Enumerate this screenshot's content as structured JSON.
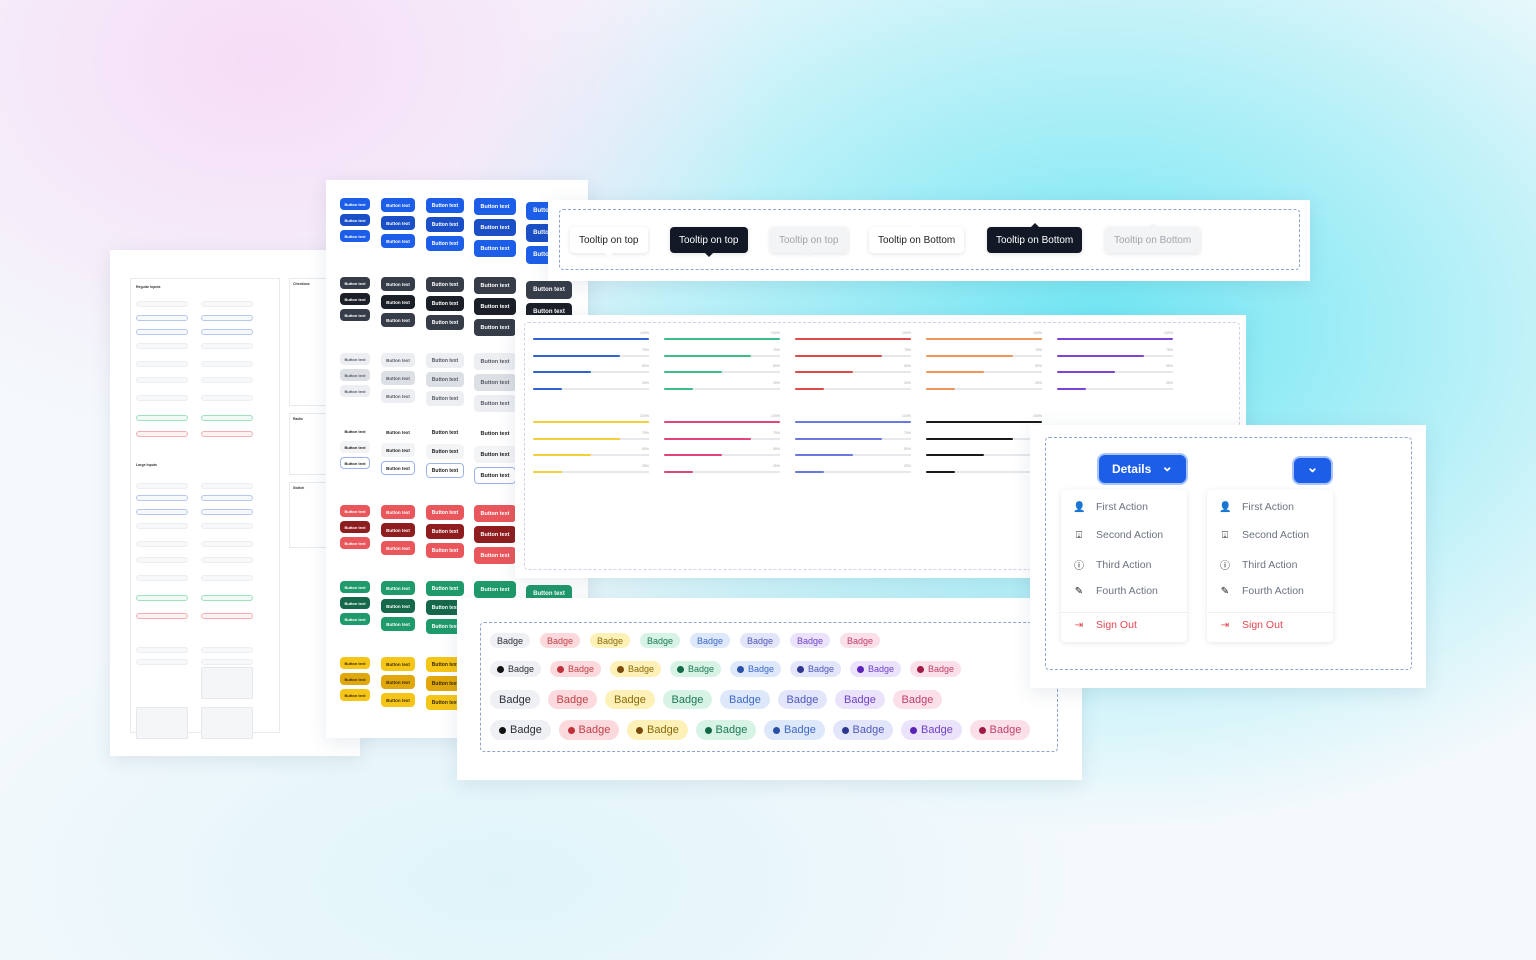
{
  "forms": {
    "regular_title": "Regular Inputs",
    "large_title": "Large Inputs",
    "checkbox_title": "Checkbox",
    "radio_title": "Radio",
    "switch_title": "Switch"
  },
  "buttons": {
    "label": "Button text",
    "groups": [
      {
        "name": "primary",
        "colors": [
          "#1d5ee8",
          "#1a4fc6",
          "#1d5ee8"
        ],
        "text": "#ffffff"
      },
      {
        "name": "dark",
        "colors": [
          "#363c48",
          "#1b1f28",
          "#363c48"
        ],
        "text": "#ffffff"
      },
      {
        "name": "light",
        "colors": [
          "#eceef1",
          "#dcdfe4",
          "#eceef1"
        ],
        "text": "#555b66"
      },
      {
        "name": "outline",
        "colors": [
          "#ffffff",
          "#f3f4f6",
          "#ffffff"
        ],
        "text": "#222222",
        "border": "#9db4ea"
      },
      {
        "name": "danger",
        "colors": [
          "#e9575c",
          "#8f1c1f",
          "#e9575c"
        ],
        "text": "#ffffff"
      },
      {
        "name": "success",
        "colors": [
          "#1f9a6a",
          "#15684a",
          "#1f9a6a"
        ],
        "text": "#ffffff"
      },
      {
        "name": "warning",
        "colors": [
          "#f5c518",
          "#e0a80c",
          "#f5c518"
        ],
        "text": "#3a2a00"
      }
    ]
  },
  "tooltips": [
    {
      "label": "Tooltip on top",
      "style": "light",
      "arrow": "bottom"
    },
    {
      "label": "Tooltip on top",
      "style": "dark",
      "arrow": "bottom"
    },
    {
      "label": "Tooltip on top",
      "style": "muted",
      "arrow": "bottom"
    },
    {
      "label": "Tooltip on Bottom",
      "style": "light",
      "arrow": "top"
    },
    {
      "label": "Tooltip on Bottom",
      "style": "dark",
      "arrow": "top"
    },
    {
      "label": "Tooltip on Bottom",
      "style": "muted",
      "arrow": "top"
    }
  ],
  "progress": {
    "values": [
      100,
      75,
      50,
      25
    ],
    "labels": [
      "100%",
      "75%",
      "50%",
      "25%"
    ],
    "colors": [
      "#2f62d3",
      "#3dbd8a",
      "#dc4a4a",
      "#f0955a",
      "#7b43d6",
      "#f5cf3a",
      "#e0457d",
      "#6a79e0",
      "#1a1a1a"
    ]
  },
  "badges": {
    "label": "Badge",
    "colors": [
      {
        "bg": "#eef0f3",
        "fg": "#2a2f38",
        "dot": "#111"
      },
      {
        "bg": "#fbd9dc",
        "fg": "#c0424a",
        "dot": "#c0303a"
      },
      {
        "bg": "#fdf1b8",
        "fg": "#8a6a08",
        "dot": "#7a4a08"
      },
      {
        "bg": "#d7f3e6",
        "fg": "#1c7a52",
        "dot": "#136845"
      },
      {
        "bg": "#dde8fb",
        "fg": "#3f68c8",
        "dot": "#2a4fa8"
      },
      {
        "bg": "#e3e6fb",
        "fg": "#4f58b8",
        "dot": "#2e3690"
      },
      {
        "bg": "#ebe3fb",
        "fg": "#7040c8",
        "dot": "#5a22b8"
      },
      {
        "bg": "#fbe0ea",
        "fg": "#c0406a",
        "dot": "#a01a48"
      }
    ]
  },
  "dropdown": {
    "button_label": "Details",
    "items": [
      {
        "label": "First Action",
        "icon": "user-plus-icon",
        "glyph": "👤"
      },
      {
        "label": "Second Action",
        "icon": "inbox-download-icon",
        "glyph": "⍗"
      },
      {
        "label": "Third Action",
        "icon": "info-circle-icon",
        "glyph": "ⓘ"
      },
      {
        "label": "Fourth Action",
        "icon": "edit-icon",
        "glyph": "✎"
      }
    ],
    "sign_out": {
      "label": "Sign Out",
      "icon": "sign-out-icon",
      "glyph": "⇥"
    },
    "chevron": "⌄",
    "accent": "#1d5ee8"
  }
}
